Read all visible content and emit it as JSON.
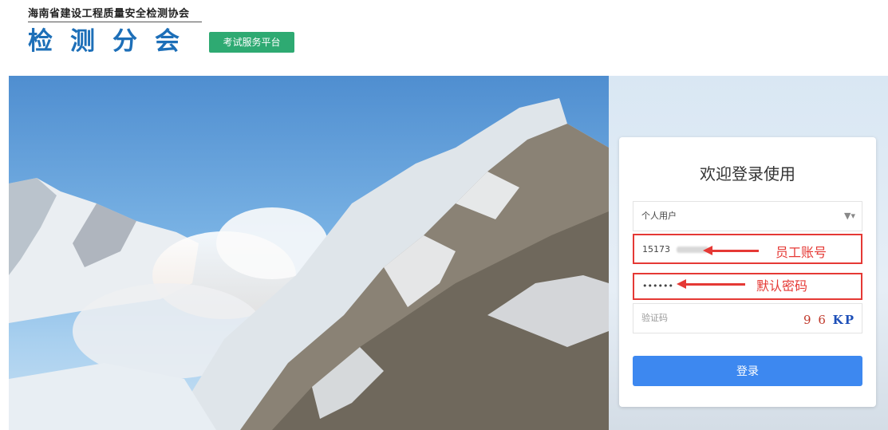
{
  "header": {
    "org_name": "海南省建设工程质量安全检测协会",
    "brand": "检测分会",
    "badge": "考试服务平台"
  },
  "login": {
    "title": "欢迎登录使用",
    "user_type": "个人用户",
    "account_value": "15173",
    "password_value": "••••••",
    "captcha_placeholder": "验证码",
    "captcha_chars": "9 6 ",
    "captcha_chars_2": "KP",
    "submit_label": "登录"
  },
  "annotations": {
    "account_note": "员工账号",
    "password_note": "默认密码"
  },
  "colors": {
    "brand_blue": "#1d6fb8",
    "badge_green": "#2eaa72",
    "button_blue": "#3d88f0",
    "annotation_red": "#e53935"
  }
}
